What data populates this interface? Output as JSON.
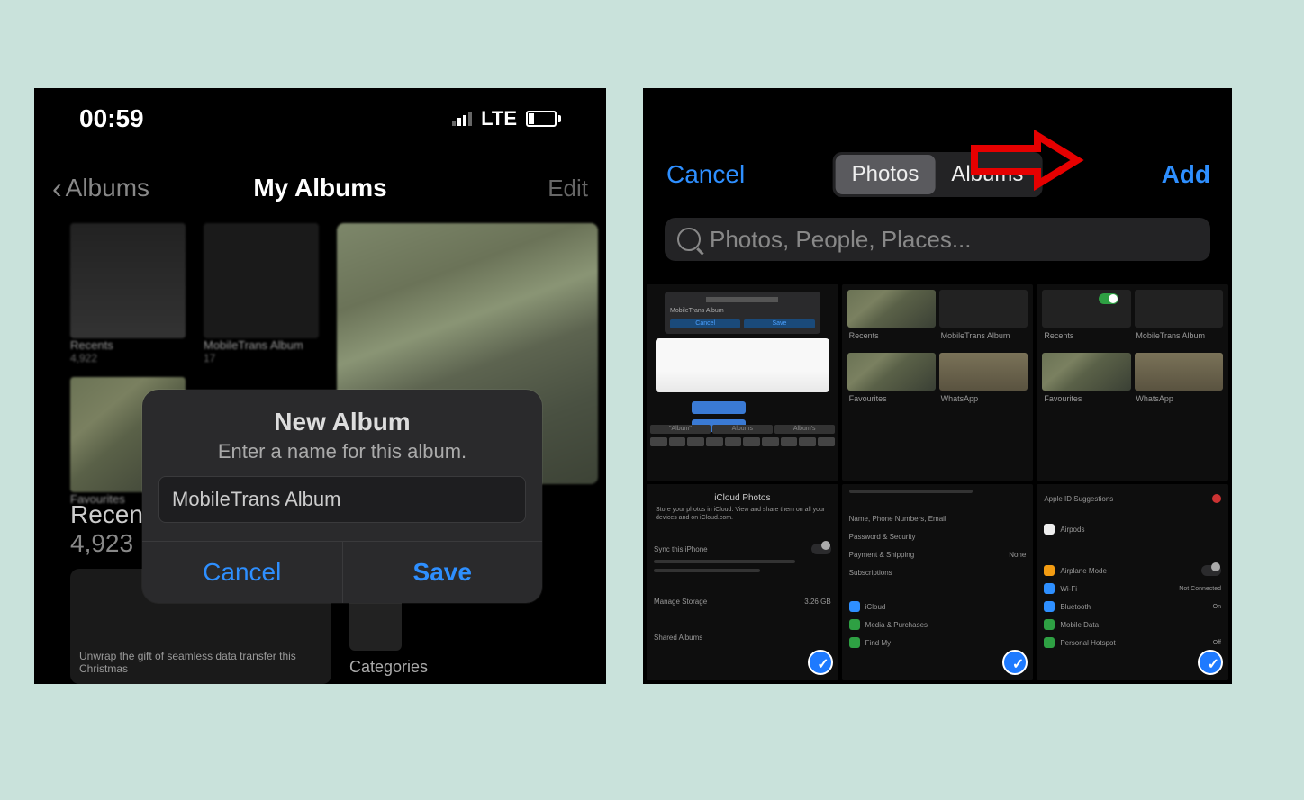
{
  "left": {
    "status": {
      "time": "00:59",
      "network": "LTE"
    },
    "nav": {
      "back": "Albums",
      "title": "My Albums",
      "edit": "Edit"
    },
    "albums": [
      {
        "name": "Recents",
        "count": "4,922"
      },
      {
        "name": "MobileTrans Album",
        "count": "17"
      },
      {
        "name": "Favourites",
        "count": ""
      }
    ],
    "largeAlbum": {
      "name": "Recents",
      "count": "4,923"
    },
    "bottom": {
      "banner": "Unwrap the gift of seamless data transfer this Christmas",
      "categories": "Categories"
    },
    "dialog": {
      "title": "New Album",
      "subtitle": "Enter a name for this album.",
      "input": "MobileTrans Album",
      "cancel": "Cancel",
      "save": "Save"
    }
  },
  "right": {
    "nav": {
      "cancel": "Cancel",
      "seg1": "Photos",
      "seg2": "Albums",
      "add": "Add"
    },
    "search": {
      "placeholder": "Photos, People, Places..."
    },
    "gridHints": {
      "row1c1_dialog_title": "MobileTrans Album",
      "row1c1_cancel": "Cancel",
      "row1c1_save": "Save",
      "row1c2_fav": "Favourites",
      "row1c2_wa": "WhatsApp",
      "row1c2_mt": "MobileTrans Album",
      "row1c2_rec": "Recents",
      "row1c3_rec": "Recents",
      "row1c3_mt": "MobileTrans Album",
      "row2c1_tab1": "\"Album\"",
      "row2c1_tab2": "Albums",
      "row2c1_tab3": "Album's",
      "row2c1_header": "iCloud Photos",
      "row2c1_sub": "Store your photos in iCloud. View and share them on all your devices and on iCloud.com.",
      "row2c1_sync": "Sync this iPhone",
      "row2c1_manage": "Manage Storage",
      "row2c1_manage_val": "3.26 GB",
      "row2c1_shared": "Shared Albums",
      "row2c2_r1": "Name, Phone Numbers, Email",
      "row2c2_r2": "Password & Security",
      "row2c2_r3": "Payment & Shipping",
      "row2c2_r3v": "None",
      "row2c2_r4": "Subscriptions",
      "row2c2_r5": "iCloud",
      "row2c2_r6": "Media & Purchases",
      "row2c2_r7": "Find My",
      "row2c3_r1": "Apple ID Suggestions",
      "row2c3_r2": "Airpods",
      "row2c3_r3": "Airplane Mode",
      "row2c3_r4": "Wi-Fi",
      "row2c3_r4v": "Not Connected",
      "row2c3_r5": "Bluetooth",
      "row2c3_r5v": "On",
      "row2c3_r6": "Mobile Data",
      "row2c3_r7": "Personal Hotspot",
      "row2c3_r7v": "Off"
    }
  }
}
